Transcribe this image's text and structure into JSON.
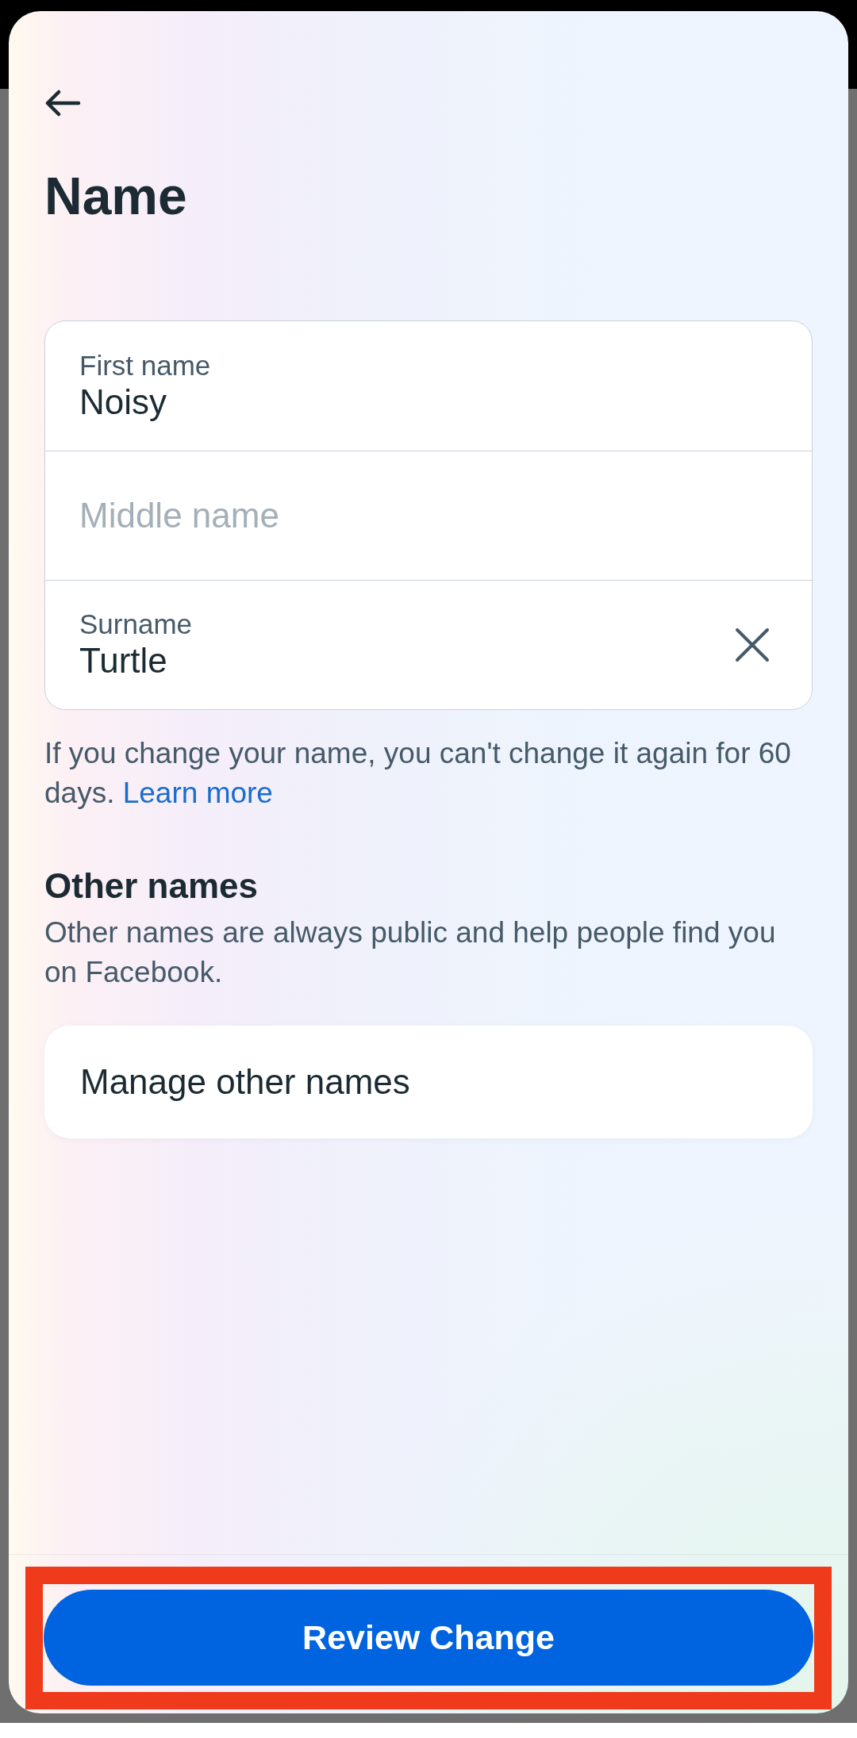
{
  "header": {
    "title": "Name"
  },
  "name_fields": [
    {
      "label": "First name",
      "value": "Noisy",
      "clearable": false
    },
    {
      "placeholder": "Middle name",
      "clearable": false
    },
    {
      "label": "Surname",
      "value": "Turtle",
      "clearable": true
    }
  ],
  "notice": {
    "text": "If you change your name, you can't change it again for 60 days.",
    "link": "Learn more"
  },
  "other_names": {
    "heading": "Other names",
    "description": "Other names are always public and help people find you on Facebook.",
    "manage_button": "Manage other names"
  },
  "footer": {
    "primary_button": "Review Change"
  }
}
